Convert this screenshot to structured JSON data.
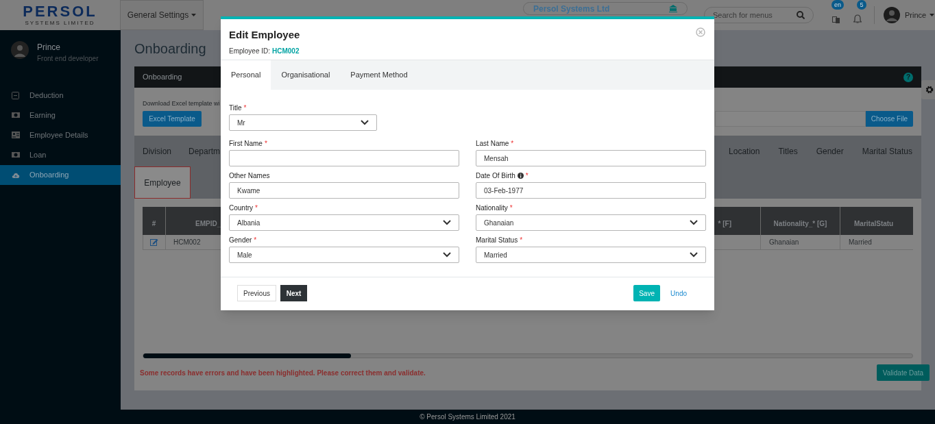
{
  "header": {
    "logo": "PERSOL",
    "logo_tagline": "SYSTEMS LIMITED",
    "menu": "General Settings",
    "company": "Persol Systems Ltd",
    "search_placeholder": "Search for menus",
    "language_badge": "en",
    "notification_count": "5",
    "user": "Prince"
  },
  "sidebar": {
    "user_name": "Prince",
    "user_role": "Front end developer",
    "items": [
      {
        "label": "Deduction",
        "selected": false
      },
      {
        "label": "Earning",
        "selected": false
      },
      {
        "label": "Employee Details",
        "selected": false
      },
      {
        "label": "Loan",
        "selected": false
      },
      {
        "label": "Onboarding",
        "selected": true
      }
    ]
  },
  "page": {
    "title": "Onboarding",
    "card_title": "Onboarding",
    "help": "?",
    "download_text": "Download Excel template wi",
    "template_button": "Excel Template",
    "file_button": "Choose File",
    "sheet_tabs": [
      {
        "label": "Division"
      },
      {
        "label": "Departm"
      },
      {
        "label": "Location"
      },
      {
        "label": "Titles"
      },
      {
        "label": "Gender"
      },
      {
        "label": "Marital Status"
      }
    ],
    "sub_tabs": [
      {
        "label": "Employee",
        "selected": true
      }
    ],
    "table": {
      "columns": [
        "#",
        "EMPID_",
        "* [F]",
        "Nationality_* [G]",
        "MaritalStatu"
      ],
      "rows": [
        {
          "empid": "HCM002",
          "nationality": "Ghanaian",
          "marital_status": "Married"
        }
      ]
    },
    "error": "Some records have errors and have been highlighted. Please correct them and validate.",
    "validate_button": "Validate Data"
  },
  "modal": {
    "title": "Edit Employee",
    "id_label": "Employee ID:",
    "id_value": "HCM002",
    "required_mark": "*",
    "tabs": [
      {
        "label": "Personal",
        "selected": true
      },
      {
        "label": "Organisational",
        "selected": false
      },
      {
        "label": "Payment Method",
        "selected": false
      }
    ],
    "title_field": {
      "label": "Title",
      "required": true,
      "kind": "select",
      "value": "Mr"
    },
    "fields": [
      {
        "label": "First Name",
        "required": true,
        "kind": "text",
        "info": false
      },
      {
        "label": "Last Name",
        "required": true,
        "kind": "text",
        "info": false,
        "value": "Mensah"
      },
      {
        "label": "Other Names",
        "required": false,
        "kind": "text",
        "info": false,
        "value": "Kwame"
      },
      {
        "label": "Date Of Birth",
        "required": true,
        "kind": "text",
        "info": true,
        "value": "03-Feb-1977"
      },
      {
        "label": "Country",
        "required": true,
        "kind": "select",
        "info": false,
        "value": "Albania"
      },
      {
        "label": "Nationality",
        "required": true,
        "kind": "select",
        "info": false,
        "value": "Ghanaian"
      },
      {
        "label": "Gender",
        "required": true,
        "kind": "select",
        "info": false,
        "value": "Male"
      },
      {
        "label": "Marital Status",
        "required": true,
        "kind": "select",
        "info": false,
        "value": "Married"
      }
    ],
    "buttons": {
      "previous": "Previous",
      "next": "Next",
      "save": "Save",
      "undo": "Undo"
    }
  },
  "footer": "© Persol Systems Limited 2021"
}
